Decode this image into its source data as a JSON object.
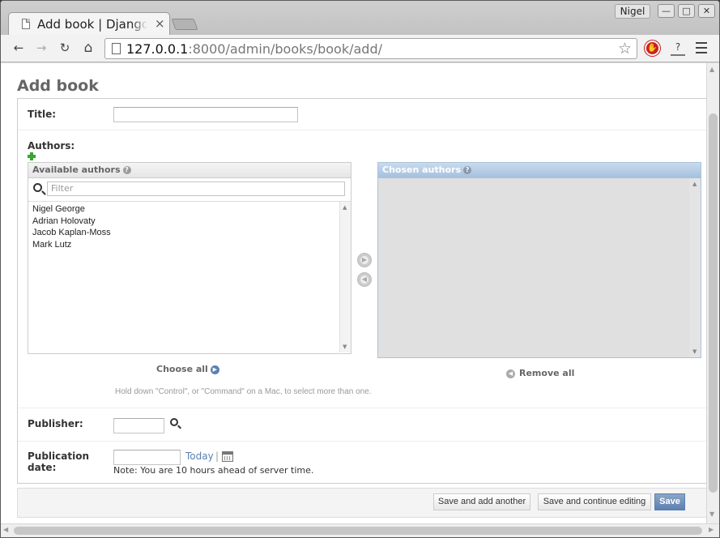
{
  "browser": {
    "tab_title": "Add book | Django site admin",
    "tab_close": "×",
    "user_name": "Nigel",
    "window_buttons": {
      "minimize": "—",
      "maximize": "□",
      "close": "✕"
    },
    "nav": {
      "back": "←",
      "forward": "→",
      "reload": "↻",
      "home": "⌂"
    },
    "url_host": "127.0.0.1",
    "url_rest": ":8000/admin/books/book/add/",
    "bookmark_star": "☆",
    "extension_stop": "✋",
    "extension_download": "?"
  },
  "page": {
    "heading": "Add book",
    "title_label": "Title:",
    "title_value": "",
    "authors_label": "Authors:",
    "available_header": "Available authors",
    "help_mark": "?",
    "filter_placeholder": "Filter",
    "available_authors": [
      "Nigel George",
      "Adrian Holovaty",
      "Jacob Kaplan-Moss",
      "Mark Lutz"
    ],
    "chosen_header": "Chosen authors",
    "choose_all": "Choose all",
    "remove_all": "Remove all",
    "arrow_right": "▶",
    "arrow_left": "◀",
    "help_text": "Hold down \"Control\", or \"Command\" on a Mac, to select more than one.",
    "publisher_label": "Publisher:",
    "publisher_value": "",
    "pubdate_label_1": "Publication",
    "pubdate_label_2": "date:",
    "pubdate_value": "",
    "today_link": "Today",
    "separator": "|",
    "timezone_note": "Note: You are 10 hours ahead of server time."
  },
  "submit": {
    "save_add_another": "Save and add another",
    "save_continue": "Save and continue editing",
    "save": "Save"
  }
}
